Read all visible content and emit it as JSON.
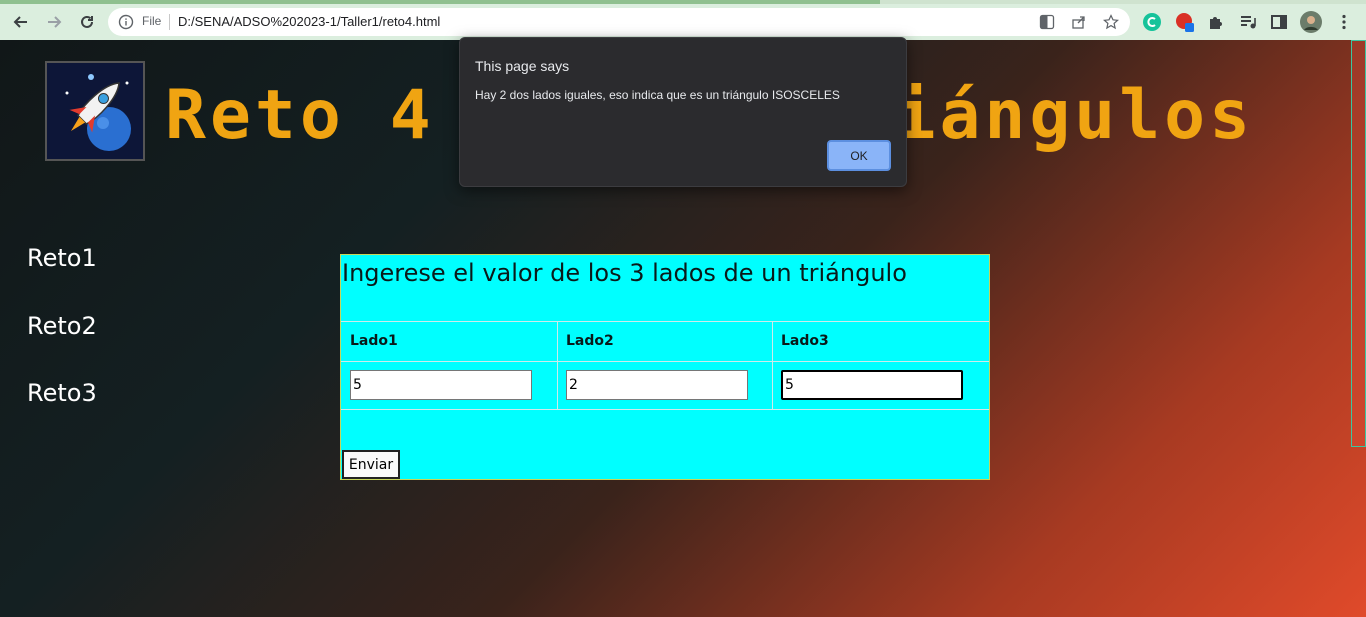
{
  "browser": {
    "url_scheme_label": "File",
    "url": "D:/SENA/ADSO%202023-1/Taller1/reto4.html"
  },
  "header": {
    "title": "Reto 4 ... Triángulos",
    "title_visible_left": "Reto 4",
    "title_visible_right": "Triángulos"
  },
  "sidebar": {
    "links": [
      "Reto1",
      "Reto2",
      "Reto3"
    ]
  },
  "form": {
    "heading": "Ingerese el valor de los 3 lados de un triángulo",
    "columns": [
      "Lado1",
      "Lado2",
      "Lado3"
    ],
    "values": [
      "5",
      "2",
      "5"
    ],
    "submit_label": "Enviar"
  },
  "dialog": {
    "title": "This page says",
    "message": "Hay 2 dos lados iguales, eso indica que es un triángulo ISOSCELES",
    "ok_label": "OK"
  },
  "colors": {
    "title": "#f0a412",
    "form_background": "#00ffff",
    "dialog_background": "#2b2b2e",
    "dialog_button": "#8ab4f8"
  }
}
